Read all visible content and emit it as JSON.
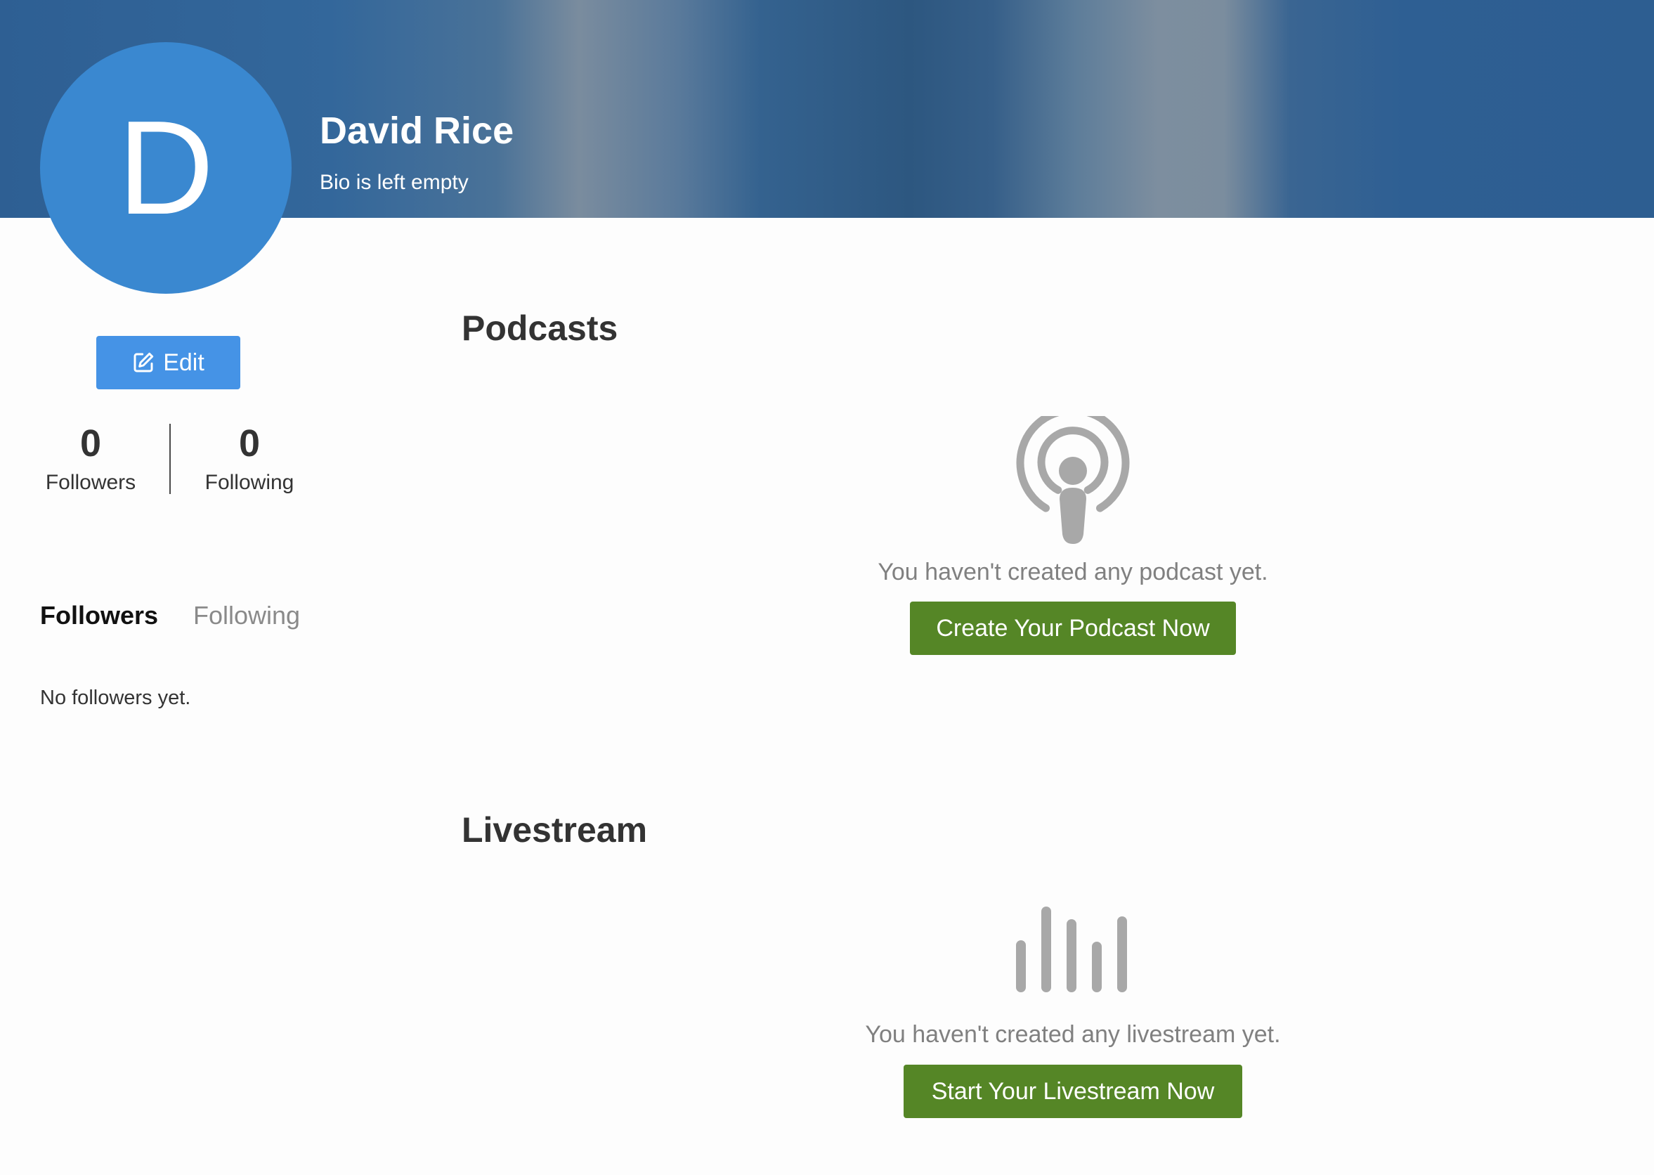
{
  "profile": {
    "avatar_initial": "D",
    "name": "David Rice",
    "bio": "Bio is left empty",
    "edit_label": "Edit"
  },
  "stats": {
    "followers_count": "0",
    "followers_label": "Followers",
    "following_count": "0",
    "following_label": "Following"
  },
  "tabs": {
    "followers_label": "Followers",
    "following_label": "Following",
    "active": "Followers",
    "empty_message": "No followers yet."
  },
  "podcasts": {
    "heading": "Podcasts",
    "icon": "podcast-icon",
    "empty_message": "You haven't created any podcast yet.",
    "cta_label": "Create Your Podcast Now"
  },
  "livestream": {
    "heading": "Livestream",
    "icon": "audio-bars-icon",
    "empty_message": "You haven't created any livestream yet.",
    "cta_label": "Start Your Livestream Now"
  },
  "colors": {
    "banner": "#2e5f93",
    "avatar": "#3a88d0",
    "edit_button": "#4593e6",
    "cta_button": "#558626",
    "muted_icon": "#a8a8a8"
  }
}
